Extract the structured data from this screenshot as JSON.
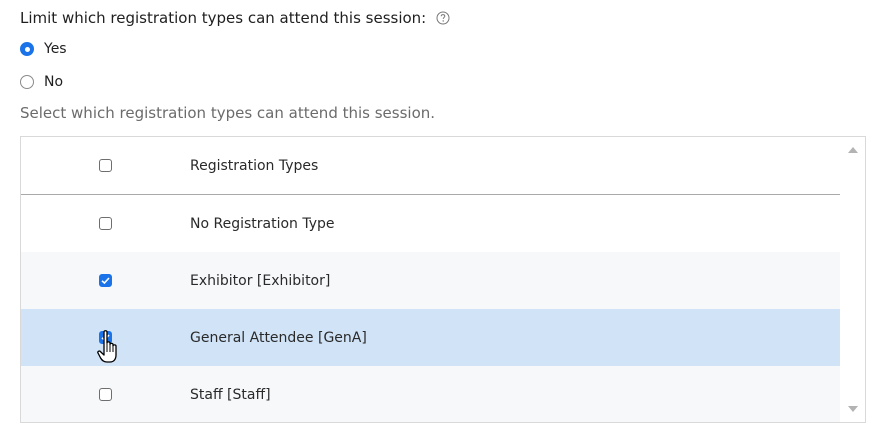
{
  "question": {
    "label": "Limit which registration types can attend this session:",
    "help_icon": "help-circle-icon"
  },
  "options": [
    {
      "label": "Yes",
      "selected": true
    },
    {
      "label": "No",
      "selected": false
    }
  ],
  "instruction": "Select which registration types can attend this session.",
  "grid": {
    "header": {
      "label": "Registration Types",
      "checked": false
    },
    "rows": [
      {
        "label": "No Registration Type",
        "checked": false
      },
      {
        "label": "Exhibitor [Exhibitor]",
        "checked": true
      },
      {
        "label": "General Attendee [GenA]",
        "checked": true,
        "highlighted": true
      },
      {
        "label": "Staff [Staff]",
        "checked": false
      }
    ]
  },
  "colors": {
    "accent": "#1a73e8",
    "selected_row": "#d0e3f7"
  }
}
